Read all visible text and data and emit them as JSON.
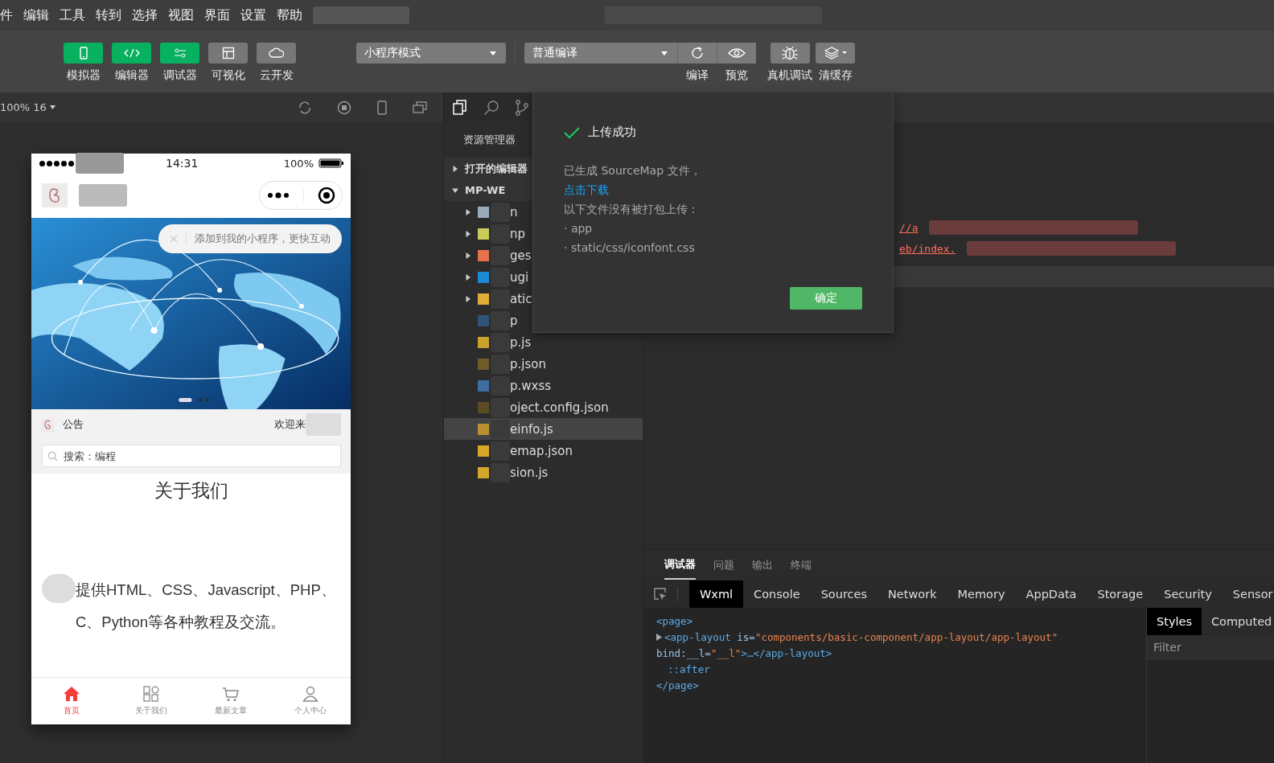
{
  "menu_bar": {
    "items": [
      "件",
      "编辑",
      "工具",
      "转到",
      "选择",
      "视图",
      "界面",
      "设置",
      "帮助"
    ]
  },
  "toolbar": {
    "left_buttons": [
      {
        "label": "模拟器",
        "on": true
      },
      {
        "label": "编辑器",
        "on": true
      },
      {
        "label": "调试器",
        "on": true
      },
      {
        "label": "可视化",
        "on": false
      },
      {
        "label": "云开发",
        "on": false
      }
    ],
    "mode_select": "小程序模式",
    "compile_select": "普通编译",
    "right_buttons": [
      {
        "label": "编译"
      },
      {
        "label": "预览"
      },
      {
        "label": "真机调试"
      },
      {
        "label": "清缓存"
      }
    ]
  },
  "simulator": {
    "zoom": "100% 16",
    "phone": {
      "time": "14:31",
      "battery": "100%",
      "tooltip": "添加到我的小程序，更快互动",
      "notice_label": "公告",
      "notice_text": "欢迎来",
      "search_placeholder": "搜索：编程",
      "heading": "关于我们",
      "paragraph": "提供HTML、CSS、Javascript、PHP、C、Python等各种教程及交流。",
      "tabs": [
        {
          "label": "首页",
          "selected": true
        },
        {
          "label": "关于我们",
          "selected": false
        },
        {
          "label": "最新文章",
          "selected": false
        },
        {
          "label": "个人中心",
          "selected": false
        }
      ]
    }
  },
  "explorer": {
    "title": "资源管理器",
    "sections": [
      {
        "label": "打开的编辑器",
        "expanded": false
      },
      {
        "label": "MP-WE",
        "expanded": true
      }
    ],
    "files": [
      {
        "name": "n",
        "kind": "folder",
        "color": "#9aabbb",
        "selected": false
      },
      {
        "name": "np",
        "kind": "folder",
        "color": "#c9cc58",
        "selected": false
      },
      {
        "name": "ges",
        "kind": "folder",
        "color": "#e8704c",
        "selected": false
      },
      {
        "name": "ugi",
        "kind": "folder",
        "color": "#1a8ad4",
        "selected": false
      },
      {
        "name": "atic",
        "kind": "folder",
        "color": "#e0ad38",
        "selected": false
      },
      {
        "name": "p",
        "kind": "file",
        "color": "#2f5478",
        "selected": false
      },
      {
        "name": "p.js",
        "kind": "file",
        "color": "#c9a12c",
        "selected": false
      },
      {
        "name": "p.json",
        "kind": "file",
        "color": "#6e5c2a",
        "selected": false
      },
      {
        "name": "p.wxss",
        "kind": "file",
        "color": "#3d6fa3",
        "selected": false
      },
      {
        "name": "oject.config.json",
        "kind": "file",
        "color": "#5c4c24",
        "selected": false
      },
      {
        "name": "einfo.js",
        "kind": "file",
        "color": "#b89030",
        "selected": true
      },
      {
        "name": "emap.json",
        "kind": "file",
        "color": "#d8a928",
        "selected": false
      },
      {
        "name": "sion.js",
        "kind": "file",
        "color": "#d4a62a",
        "selected": false
      }
    ]
  },
  "dialog": {
    "title": "上传成功",
    "message": "已生成 SourceMap 文件，",
    "link": "点击下载",
    "note": "以下文件没有被打包上传：",
    "files": [
      "· app",
      "· static/css/iconfont.css"
    ],
    "button": "确定"
  },
  "editor": {
    "lines": [
      "//a",
      "eb/index."
    ]
  },
  "debugger": {
    "tabs": [
      {
        "label": "调试器",
        "selected": true
      },
      {
        "label": "问题",
        "selected": false
      },
      {
        "label": "输出",
        "selected": false
      },
      {
        "label": "终端",
        "selected": false
      }
    ],
    "devtools_tabs": [
      {
        "label": "Wxml",
        "selected": true
      },
      {
        "label": "Console",
        "selected": false
      },
      {
        "label": "Sources",
        "selected": false
      },
      {
        "label": "Network",
        "selected": false
      },
      {
        "label": "Memory",
        "selected": false
      },
      {
        "label": "AppData",
        "selected": false
      },
      {
        "label": "Storage",
        "selected": false
      },
      {
        "label": "Security",
        "selected": false
      },
      {
        "label": "Sensor",
        "selected": false
      }
    ],
    "wxml": [
      {
        "indent": false,
        "expandable": false,
        "parts": [
          {
            "kind": "tag",
            "text": "<page>"
          }
        ]
      },
      {
        "indent": false,
        "expandable": true,
        "parts": [
          {
            "kind": "tag",
            "text": "<app-layout "
          },
          {
            "kind": "attr",
            "text": "is="
          },
          {
            "kind": "string",
            "text": "\"components/basic-component/app-layout/app-layout\""
          }
        ]
      },
      {
        "indent": false,
        "expandable": false,
        "parts": [
          {
            "kind": "attr",
            "text": "bind:__l="
          },
          {
            "kind": "string",
            "text": "\"__l\""
          },
          {
            "kind": "tag",
            "text": ">…</app-layout>"
          }
        ]
      },
      {
        "indent": true,
        "expandable": false,
        "parts": [
          {
            "kind": "tag",
            "text": "::after"
          }
        ]
      },
      {
        "indent": false,
        "expandable": false,
        "parts": [
          {
            "kind": "tag",
            "text": "</page>"
          }
        ]
      }
    ],
    "style_tabs": [
      {
        "label": "Styles",
        "selected": true
      },
      {
        "label": "Computed",
        "selected": false
      }
    ],
    "filter_placeholder": "Filter"
  }
}
